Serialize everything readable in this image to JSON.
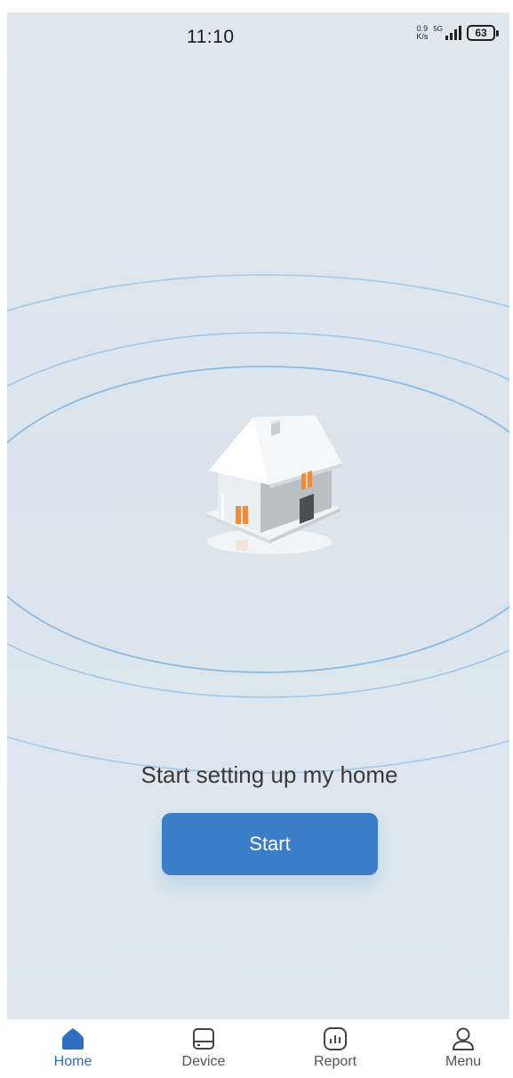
{
  "status_bar": {
    "time": "11:10",
    "net_speed_value": "0.9",
    "net_speed_unit": "K/s",
    "network_type": "5G",
    "battery": "63"
  },
  "main": {
    "headline": "Start setting up my home",
    "start_button": "Start",
    "illustration": "house-illustration"
  },
  "tabbar": {
    "tabs": [
      {
        "label": "Home",
        "icon": "home-icon",
        "active": true
      },
      {
        "label": "Device",
        "icon": "device-icon",
        "active": false
      },
      {
        "label": "Report",
        "icon": "report-icon",
        "active": false
      },
      {
        "label": "Menu",
        "icon": "person-icon",
        "active": false
      }
    ]
  },
  "colors": {
    "accent": "#3a7ec8",
    "active_tab": "#2f6fc0",
    "background": "#dde6ee",
    "ring": "#7fb6e6"
  }
}
